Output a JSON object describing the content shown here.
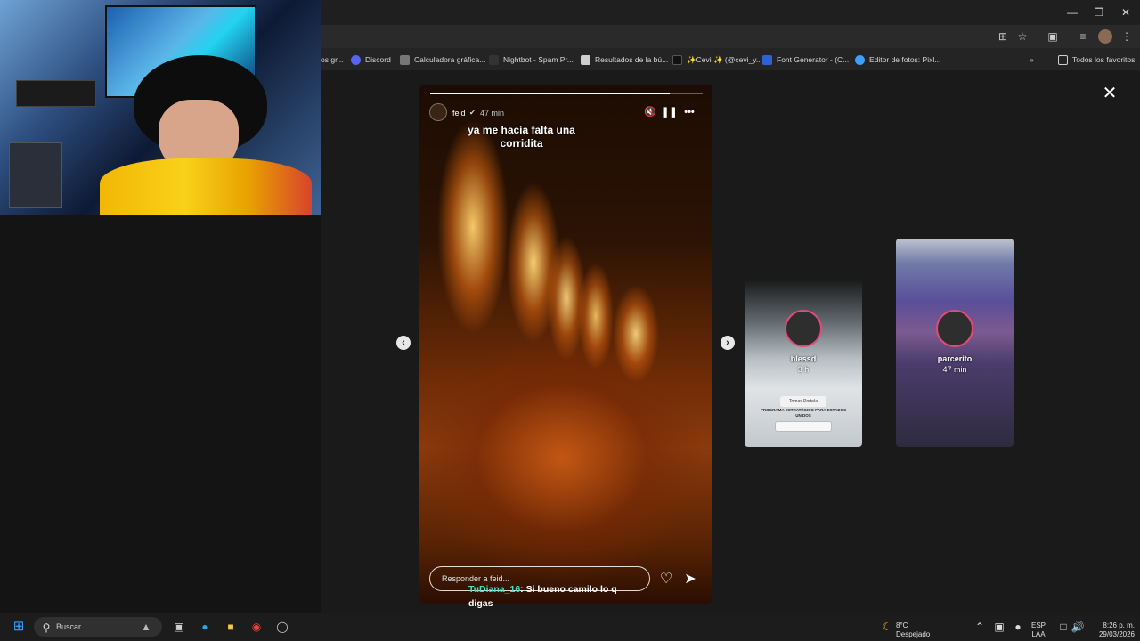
{
  "browser": {
    "bookmarks": [
      {
        "label": "os gr...",
        "color": "#555555"
      },
      {
        "label": "Discord",
        "color": "#5865f2"
      },
      {
        "label": "Calculadora gráfica...",
        "color": "#888888"
      },
      {
        "label": "Nightbot - Spam Pr...",
        "color": "#222222"
      },
      {
        "label": "Resultados de la bú...",
        "color": "#cfcfcf"
      },
      {
        "label": "✨Cevi ✨ (@cevi_y...",
        "color": "#111111"
      },
      {
        "label": "Font Generator - (C...",
        "color": "#2f62d6"
      },
      {
        "label": "Editor de fotos: Pixl...",
        "color": "#3aa0ff"
      }
    ],
    "all_favorites_label": "Todos los favoritos",
    "overflow_icon": "chevron-double-right-icon"
  },
  "story": {
    "username": "feid",
    "time": "47 min",
    "caption_line1": "ya me hacía falta una",
    "caption_line2": "corridita",
    "reply_placeholder": "Responder a feid...",
    "progress": 0.88
  },
  "previews": [
    {
      "username": "blessd",
      "time": "3 h",
      "card_top": "Tomas Portela",
      "card_text": "PROGRAMA ESTRATÉGICO PARA ESTADOS UNIDOS"
    },
    {
      "username": "parcerito",
      "time": "47 min"
    }
  ],
  "chat": {
    "name": "TuDiana_16",
    "message_line1": ": Si bueno camilo lo q",
    "message_line2": "digas"
  },
  "taskbar": {
    "search_placeholder": "Buscar",
    "weather_temp": "8°C",
    "weather_desc": "Despejado",
    "lang_line1": "ESP",
    "lang_line2": "LAA",
    "clock_time": "8:26 p. m.",
    "clock_date": "29/03/2026"
  },
  "colors": {
    "accent_chat": "#43e0c7",
    "story_ring": "#e14b7a"
  }
}
